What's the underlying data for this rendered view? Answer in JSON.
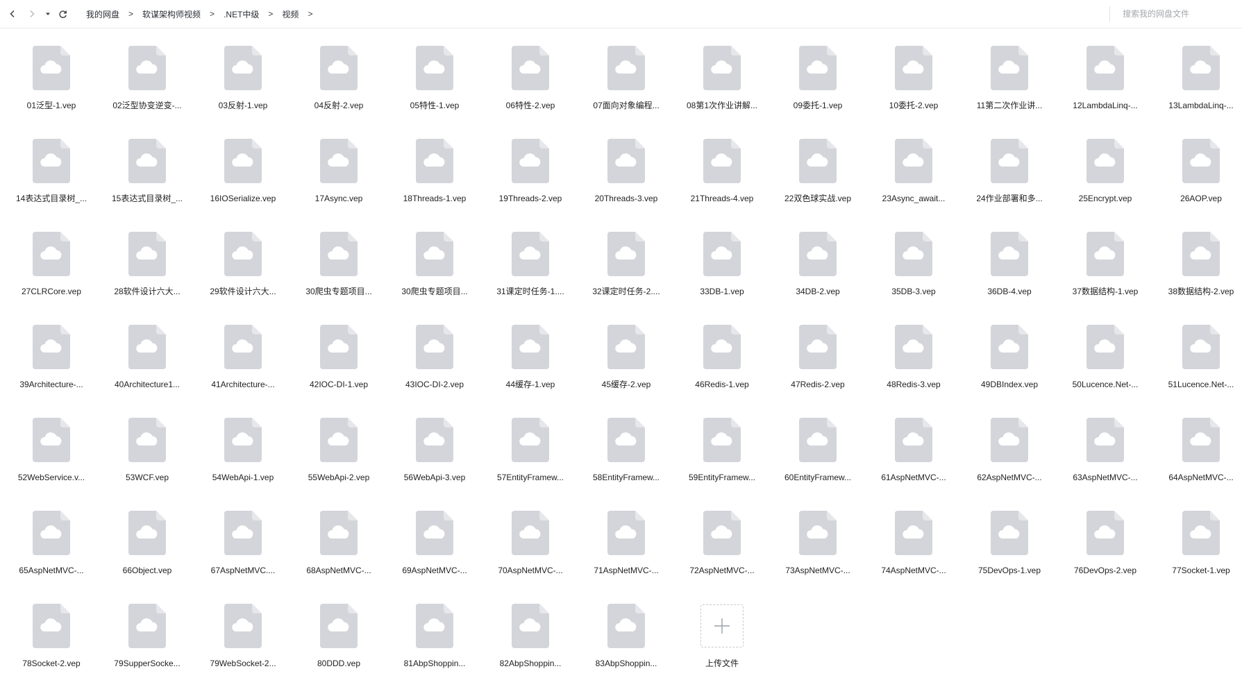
{
  "nav": {
    "back_icon": "chevron-left-icon",
    "forward_icon": "chevron-right-icon",
    "history_icon": "caret-down-icon",
    "refresh_icon": "refresh-icon"
  },
  "breadcrumb": [
    "我的网盘",
    "软谋架构师视频",
    ".NET中级",
    "视频"
  ],
  "breadcrumb_separator": ">",
  "search": {
    "placeholder": "搜索我的网盘文件"
  },
  "colors": {
    "file_icon": "#d3d5da",
    "cloud": "#ffffff",
    "accent": "#9aa0a8"
  },
  "files": [
    "01泛型-1.vep",
    "02泛型协变逆变-...",
    "03反射-1.vep",
    "04反射-2.vep",
    "05特性-1.vep",
    "06特性-2.vep",
    "07面向对象编程...",
    "08第1次作业讲解...",
    "09委托-1.vep",
    "10委托-2.vep",
    "11第二次作业讲...",
    "12LambdaLinq-...",
    "13LambdaLinq-...",
    "14表达式目录树_...",
    "15表达式目录树_...",
    "16IOSerialize.vep",
    "17Async.vep",
    "18Threads-1.vep",
    "19Threads-2.vep",
    "20Threads-3.vep",
    "21Threads-4.vep",
    "22双色球实战.vep",
    "23Async_await...",
    "24作业部署和多...",
    "25Encrypt.vep",
    "26AOP.vep",
    "27CLRCore.vep",
    "28软件设计六大...",
    "29软件设计六大...",
    "30爬虫专题项目...",
    "30爬虫专题项目...",
    "31课定时任务-1....",
    "32课定时任务-2....",
    "33DB-1.vep",
    "34DB-2.vep",
    "35DB-3.vep",
    "36DB-4.vep",
    "37数据结构-1.vep",
    "38数据结构-2.vep",
    "39Architecture-...",
    "40Architecture1...",
    "41Architecture-...",
    "42IOC-DI-1.vep",
    "43IOC-DI-2.vep",
    "44缓存-1.vep",
    "45缓存-2.vep",
    "46Redis-1.vep",
    "47Redis-2.vep",
    "48Redis-3.vep",
    "49DBIndex.vep",
    "50Lucence.Net-...",
    "51Lucence.Net-...",
    "52WebService.v...",
    "53WCF.vep",
    "54WebApi-1.vep",
    "55WebApi-2.vep",
    "56WebApi-3.vep",
    "57EntityFramew...",
    "58EntityFramew...",
    "59EntityFramew...",
    "60EntityFramew...",
    "61AspNetMVC-...",
    "62AspNetMVC-...",
    "63AspNetMVC-...",
    "64AspNetMVC-...",
    "65AspNetMVC-...",
    "66Object.vep",
    "67AspNetMVC....",
    "68AspNetMVC-...",
    "69AspNetMVC-...",
    "70AspNetMVC-...",
    "71AspNetMVC-...",
    "72AspNetMVC-...",
    "73AspNetMVC-...",
    "74AspNetMVC-...",
    "75DevOps-1.vep",
    "76DevOps-2.vep",
    "77Socket-1.vep",
    "78Socket-2.vep",
    "79SupperSocke...",
    "79WebSocket-2...",
    "80DDD.vep",
    "81AbpShoppin...",
    "82AbpShoppin...",
    "83AbpShoppin..."
  ],
  "upload": {
    "label": "上传文件",
    "icon": "plus-icon"
  }
}
